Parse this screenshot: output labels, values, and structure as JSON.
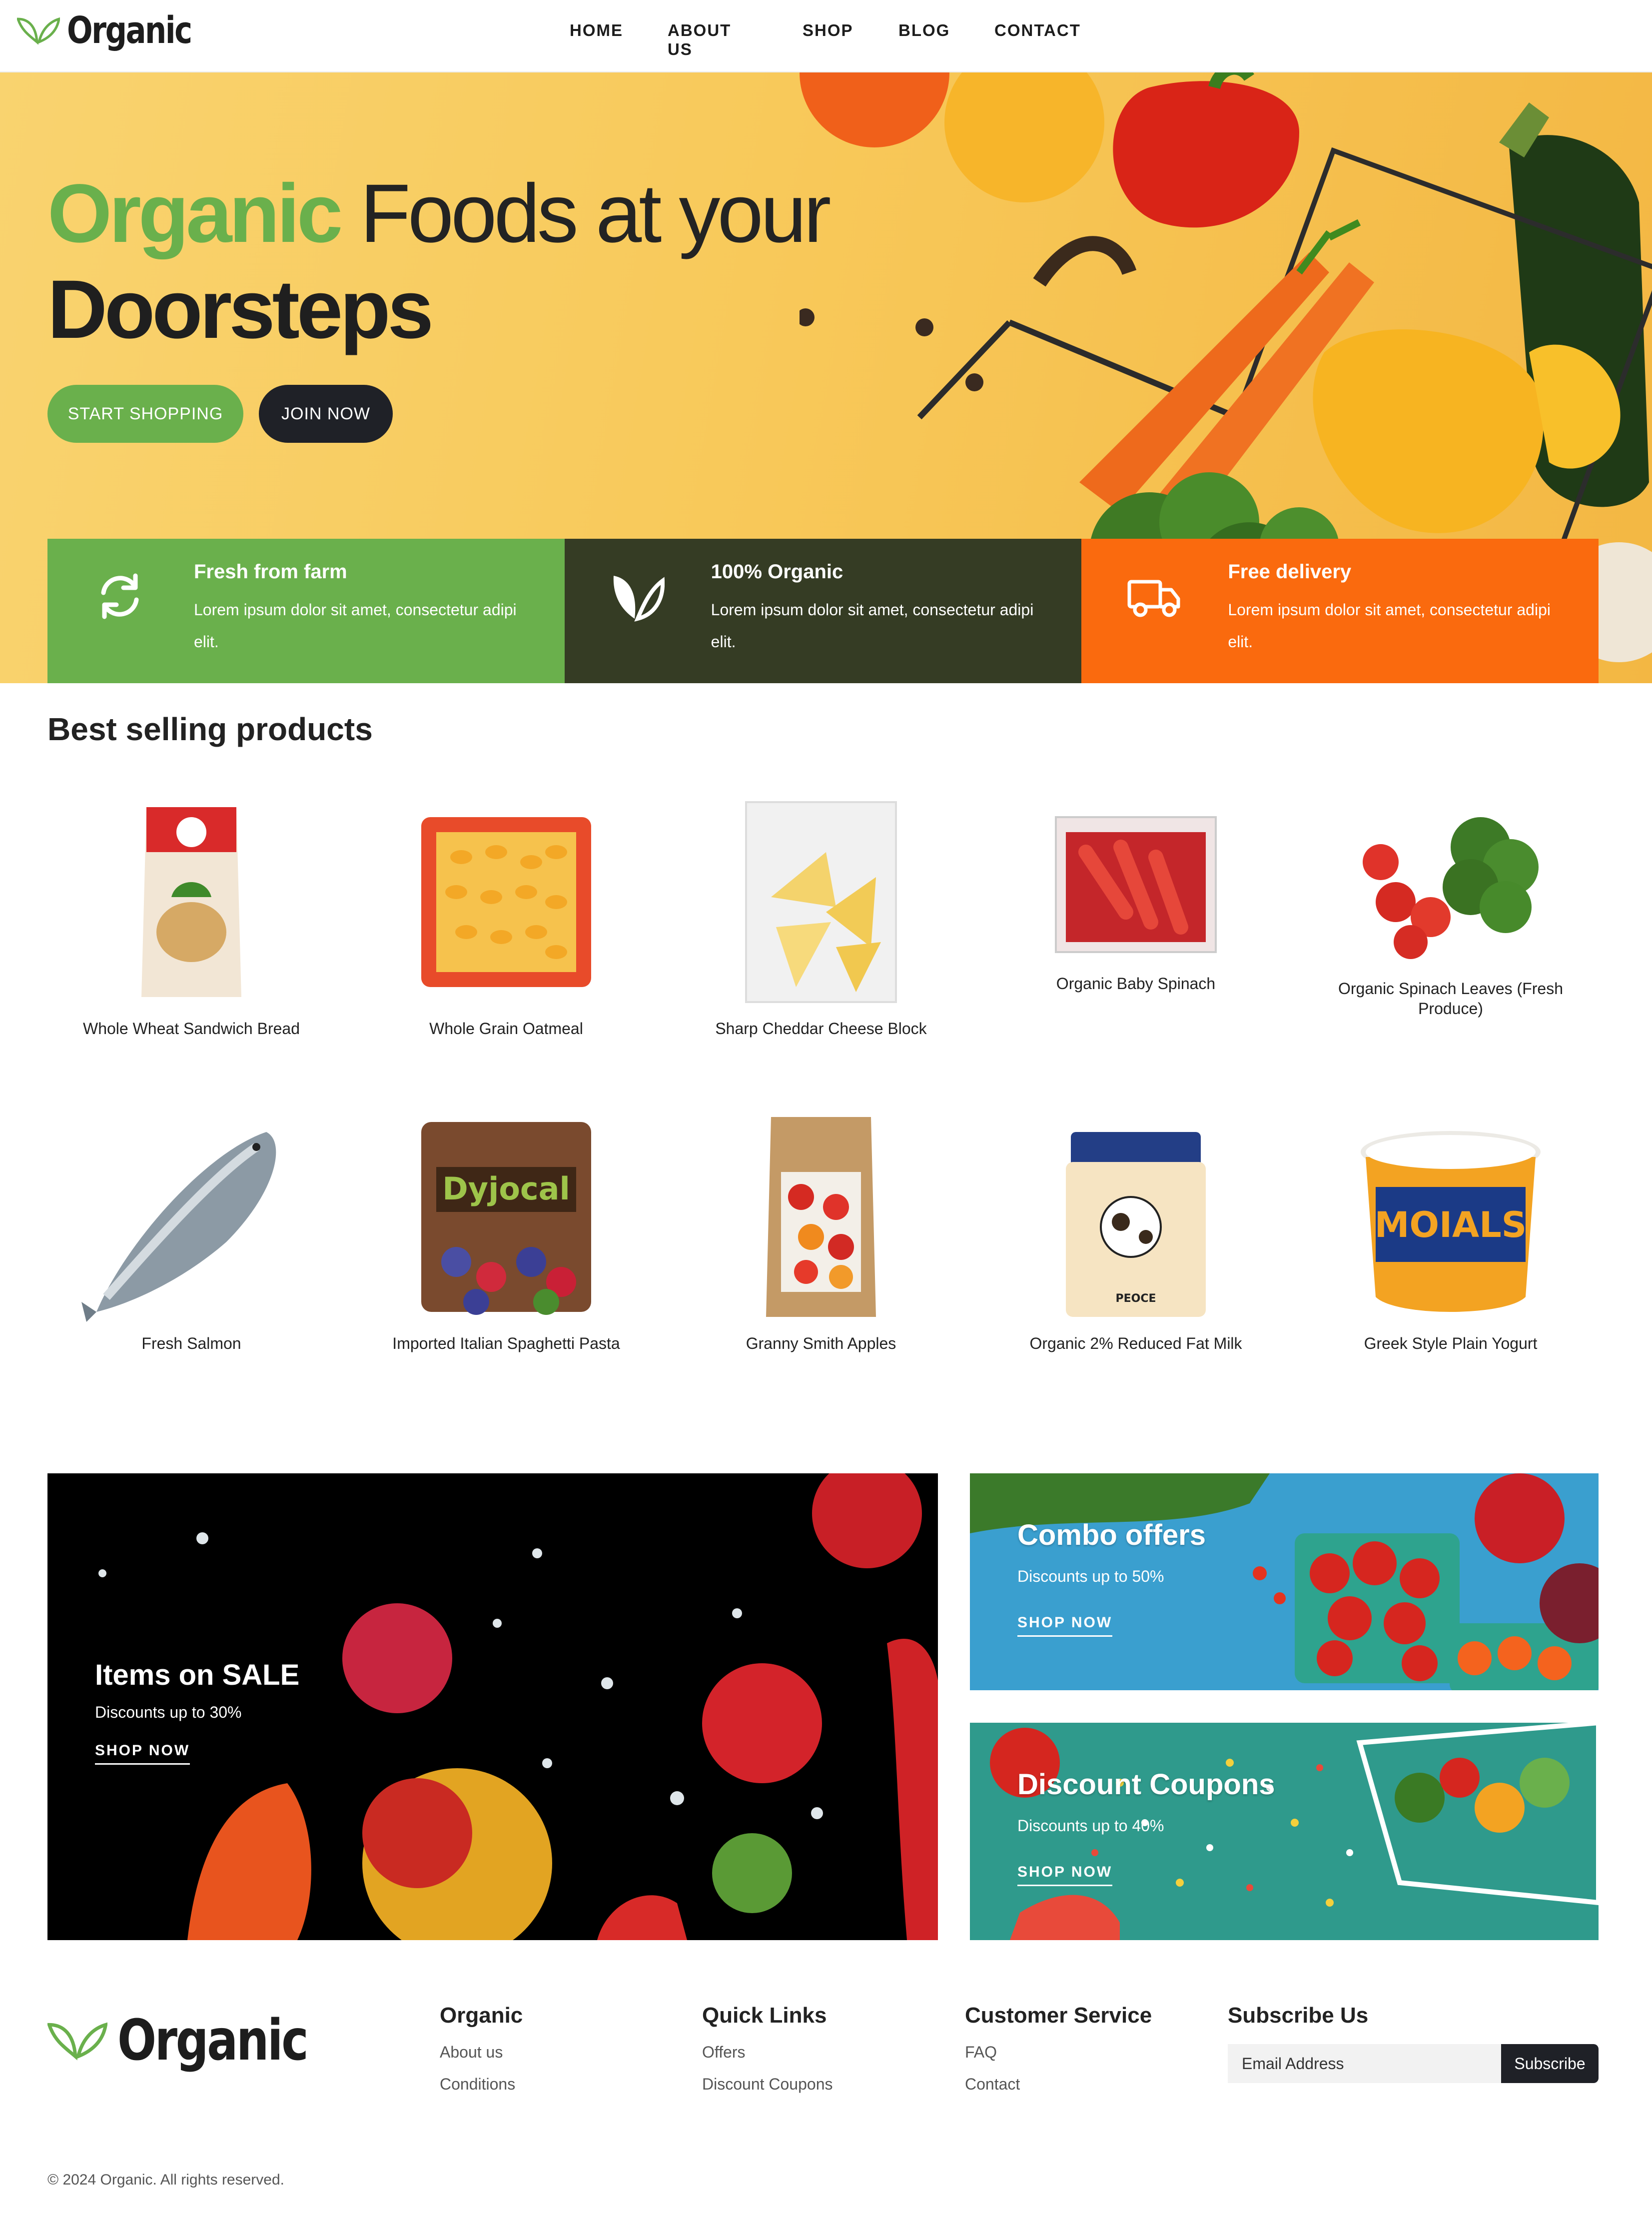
{
  "nav": {
    "logo": "Organic",
    "links": [
      "HOME",
      "ABOUT US",
      "SHOP",
      "BLOG",
      "CONTACT"
    ]
  },
  "hero": {
    "title_highlight": "Organic",
    "title_rest": "Foods at your",
    "title_line2": "Doorsteps",
    "primary_button": "START SHOPPING",
    "secondary_button": "JOIN NOW"
  },
  "features": [
    {
      "title": "Fresh from farm",
      "desc": "Lorem ipsum dolor sit amet, consectetur adipi elit.",
      "icon": "refresh-icon",
      "color": "#6ab04c"
    },
    {
      "title": "100% Organic",
      "desc": "Lorem ipsum dolor sit amet, consectetur adipi elit.",
      "icon": "leaf-icon",
      "color": "#353c24"
    },
    {
      "title": "Free delivery",
      "desc": "Lorem ipsum dolor sit amet, consectetur adipi elit.",
      "icon": "truck-icon",
      "color": "#fa6a0e"
    }
  ],
  "products": {
    "title": "Best selling products",
    "items": [
      {
        "name": "Whole Wheat Sandwich Bread"
      },
      {
        "name": "Whole Grain Oatmeal"
      },
      {
        "name": "Sharp Cheddar Cheese Block"
      },
      {
        "name": "Organic Baby Spinach"
      },
      {
        "name": "Organic Spinach Leaves (Fresh Produce)"
      },
      {
        "name": "Fresh Salmon"
      },
      {
        "name": "Imported Italian Spaghetti Pasta"
      },
      {
        "name": "Granny Smith Apples"
      },
      {
        "name": "Organic 2% Reduced Fat Milk"
      },
      {
        "name": "Greek Style Plain Yogurt"
      }
    ]
  },
  "promos": {
    "sale": {
      "title": "Items on SALE",
      "sub": "Discounts up to 30%",
      "link": "SHOP NOW"
    },
    "combo": {
      "title": "Combo offers",
      "sub": "Discounts up to 50%",
      "link": "SHOP NOW"
    },
    "coupons": {
      "title": "Discount Coupons",
      "sub": "Discounts up to 40%",
      "link": "SHOP NOW"
    }
  },
  "footer": {
    "logo": "Organic",
    "col1": {
      "title": "Organic",
      "links": [
        "About us",
        "Conditions"
      ]
    },
    "col2": {
      "title": "Quick Links",
      "links": [
        "Offers",
        "Discount Coupons"
      ]
    },
    "col3": {
      "title": "Customer Service",
      "links": [
        "FAQ",
        "Contact"
      ]
    },
    "col4": {
      "title": "Subscribe Us",
      "placeholder": "Email Address",
      "button": "Subscribe"
    },
    "copyright": "© 2024 Organic. All rights reserved."
  },
  "colors": {
    "green": "#6ab04c",
    "dark_olive": "#353c24",
    "orange": "#fa6a0e",
    "dark": "#1f2127",
    "hero_yellow": "#f8c95a"
  }
}
